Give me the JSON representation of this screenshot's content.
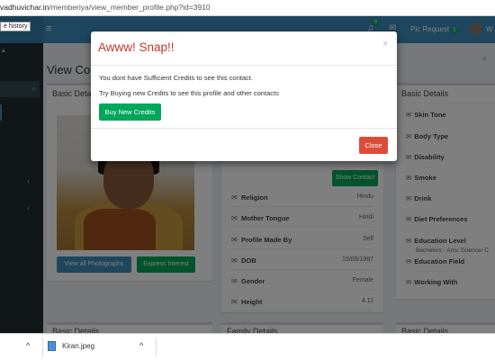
{
  "browser": {
    "url_host": "vadhuvichar.in",
    "url_path": "/memberiya/view_member_profile.php?id=3910",
    "tooltip": "e history"
  },
  "topnav": {
    "badge_count": "0",
    "pic_request_label": "Pic Request",
    "pic_request_count": "0",
    "user_name": "W"
  },
  "sidebar": {
    "top_text": "a"
  },
  "content": {
    "title": "View Co",
    "left_box_title": "Basic Deta",
    "right_box_title": "Basic Details",
    "view_photos_button": "View all Photographs",
    "express_interest_button": "Express Interest",
    "show_contact_button": "Show Contact",
    "fields": [
      {
        "label": "Religion",
        "value": "Hindu"
      },
      {
        "label": "Mother Tongue",
        "value": "Hindi"
      },
      {
        "label": "Profile Made By",
        "value": "Self"
      },
      {
        "label": "DOB",
        "value": "15/09/1987"
      },
      {
        "label": "Gender",
        "value": "Female"
      },
      {
        "label": "Height",
        "value": "4.11"
      }
    ],
    "right_fields": [
      {
        "label": "Skin Tone"
      },
      {
        "label": "Body Type"
      },
      {
        "label": "Disability"
      },
      {
        "label": "Smoke"
      },
      {
        "label": "Drink"
      },
      {
        "label": "Diet Preferences"
      },
      {
        "label": "Education Level"
      },
      {
        "label": "Education Field"
      },
      {
        "label": "Working With"
      }
    ],
    "education_level_value": "Bachelors - Arts/ Science/ C",
    "bottom_box_titles": [
      "Basic Details",
      "Family Details",
      "Basic Details"
    ]
  },
  "modal": {
    "title": "Awww! Snap!!",
    "close_x": "×",
    "line1": "You dont have Sufficient Credits to see this contact.",
    "line2": "Try Buying new Credits to see this profile and other contacts",
    "buy_button": "Buy New Credits",
    "close_button": "Close"
  },
  "download_bar": {
    "file_name": "Kiran.jpeg"
  },
  "colors": {
    "navbar": "#3c8dbc",
    "sidebar": "#222d32",
    "modal_title": "#c0392b",
    "success": "#00a65a",
    "danger": "#dd4b39"
  }
}
